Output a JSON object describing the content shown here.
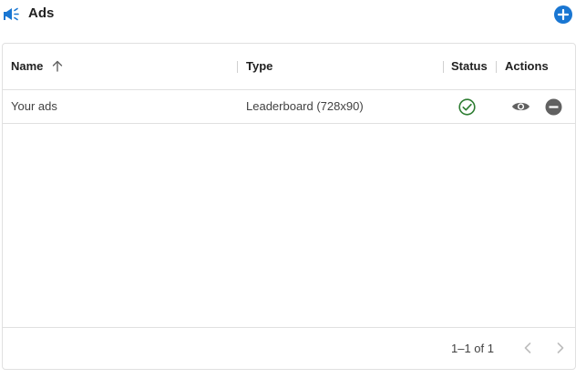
{
  "header": {
    "title": "Ads",
    "icon": "megaphone-icon",
    "add_icon": "add-circle-icon",
    "accent_color": "#1976d2"
  },
  "grid": {
    "columns": [
      {
        "label": "Name",
        "sort": "ascending"
      },
      {
        "label": "Type"
      },
      {
        "label": "Status"
      },
      {
        "label": "Actions"
      }
    ],
    "rows": [
      {
        "name": "Your ads",
        "type": "Leaderboard (728x90)",
        "status_icon": "check-circle-icon",
        "status_color": "#2e7d32",
        "actions": [
          "eye-icon",
          "remove-circle-icon"
        ]
      }
    ]
  },
  "footer": {
    "pagination": "1–1 of 1",
    "prev_icon": "chevron-left-icon",
    "next_icon": "chevron-right-icon"
  }
}
